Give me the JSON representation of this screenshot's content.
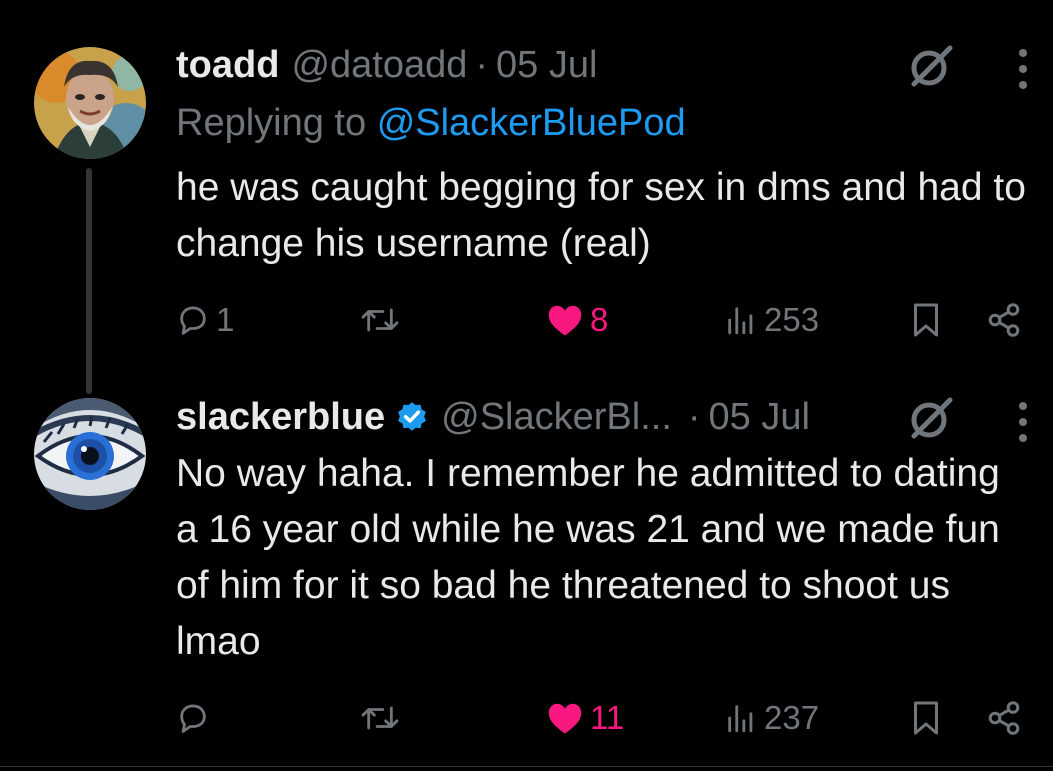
{
  "tweets": [
    {
      "display_name": "toadd",
      "handle": "@datoadd",
      "separator": "·",
      "date": "05 Jul",
      "replying_prefix": "Replying to",
      "replying_to": "@SlackerBluePod",
      "text": "he was caught begging for sex in dms and had to change his username (real)",
      "replies": "1",
      "reposts": "",
      "likes": "8",
      "views": "253",
      "liked": true
    },
    {
      "display_name": "slackerblue",
      "handle": "@SlackerBl...",
      "separator": "·",
      "date": "05 Jul",
      "verified": true,
      "text": "No way haha. I remember he admitted to dating a 16 year old while he was 21 and we made fun of him for it so bad he threatened to shoot us lmao",
      "replies": "",
      "reposts": "",
      "likes": "11",
      "views": "237",
      "liked": true
    }
  ],
  "colors": {
    "background": "#000000",
    "text": "#e7e9ea",
    "muted": "#71767b",
    "link": "#1d9bf0",
    "like": "#f91880",
    "verified": "#1d9bf0"
  },
  "icons": [
    "reply-icon",
    "repost-icon",
    "heart-icon",
    "views-icon",
    "bookmark-icon",
    "share-icon",
    "grok-icon",
    "more-icon",
    "verified-badge-icon"
  ]
}
